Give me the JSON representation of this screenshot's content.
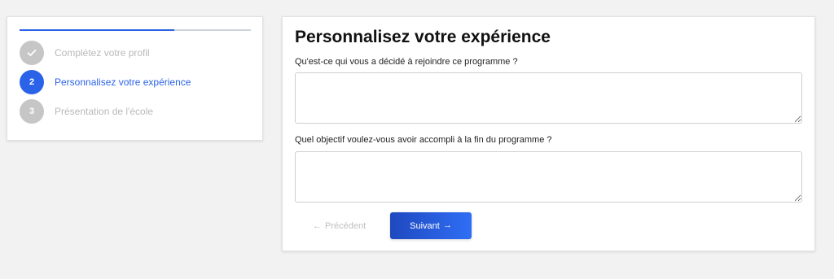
{
  "colors": {
    "accent": "#2b63e8",
    "muted": "#c6c6c6",
    "button_gradient_start": "#1f49bf",
    "button_gradient_end": "#2f6ef5"
  },
  "stepper": {
    "progress_fraction": 0.67,
    "steps": [
      {
        "number": "",
        "state": "completed",
        "icon": "check-icon",
        "label": "Complétez votre profil"
      },
      {
        "number": "2",
        "state": "active",
        "label": "Personnalisez votre expérience"
      },
      {
        "number": "3",
        "state": "upcoming",
        "label": "Présentation de l'école"
      }
    ]
  },
  "form": {
    "title": "Personnalisez votre expérience",
    "questions": [
      {
        "label": "Qu'est-ce qui vous a décidé à rejoindre ce programme ?",
        "value": ""
      },
      {
        "label": "Quel objectif voulez-vous avoir accompli à la fin du programme ?",
        "value": ""
      }
    ],
    "previous_label": "Précédent",
    "previous_icon": "arrow-left-icon",
    "next_label": "Suivant",
    "next_icon": "arrow-right-icon"
  }
}
